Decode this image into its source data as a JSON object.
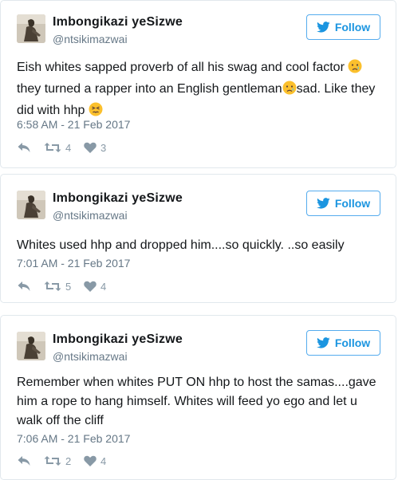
{
  "colors": {
    "accent": "#1b95e0",
    "muted": "#657786",
    "icon": "#8899a6",
    "border": "#e1e8ed",
    "emoji": "#fbc02d"
  },
  "tweets": [
    {
      "display_name": "Imbongikazi yeSizwe",
      "handle": "@ntsikimazwai",
      "follow_label": "Follow",
      "text_1": "Eish whites sapped proverb of all his swag and cool factor ",
      "text_2": " they turned a rapper into an English gentleman",
      "text_3": "sad. Like they did with hhp ",
      "timestamp": "6:58 AM - 21 Feb 2017",
      "retweets": "4",
      "likes": "3"
    },
    {
      "display_name": "Imbongikazi yeSizwe",
      "handle": "@ntsikimazwai",
      "follow_label": "Follow",
      "text_1": "Whites used hhp and dropped him....so quickly. ..so easily",
      "timestamp": "7:01 AM - 21 Feb 2017",
      "retweets": "5",
      "likes": "4"
    },
    {
      "display_name": "Imbongikazi yeSizwe",
      "handle": "@ntsikimazwai",
      "follow_label": "Follow",
      "text_1": "Remember when whites PUT ON hhp to host the samas....gave him a rope to hang himself. Whites will feed yo ego and let u walk off the cliff",
      "timestamp": "7:06 AM - 21 Feb 2017",
      "retweets": "2",
      "likes": "4"
    }
  ]
}
